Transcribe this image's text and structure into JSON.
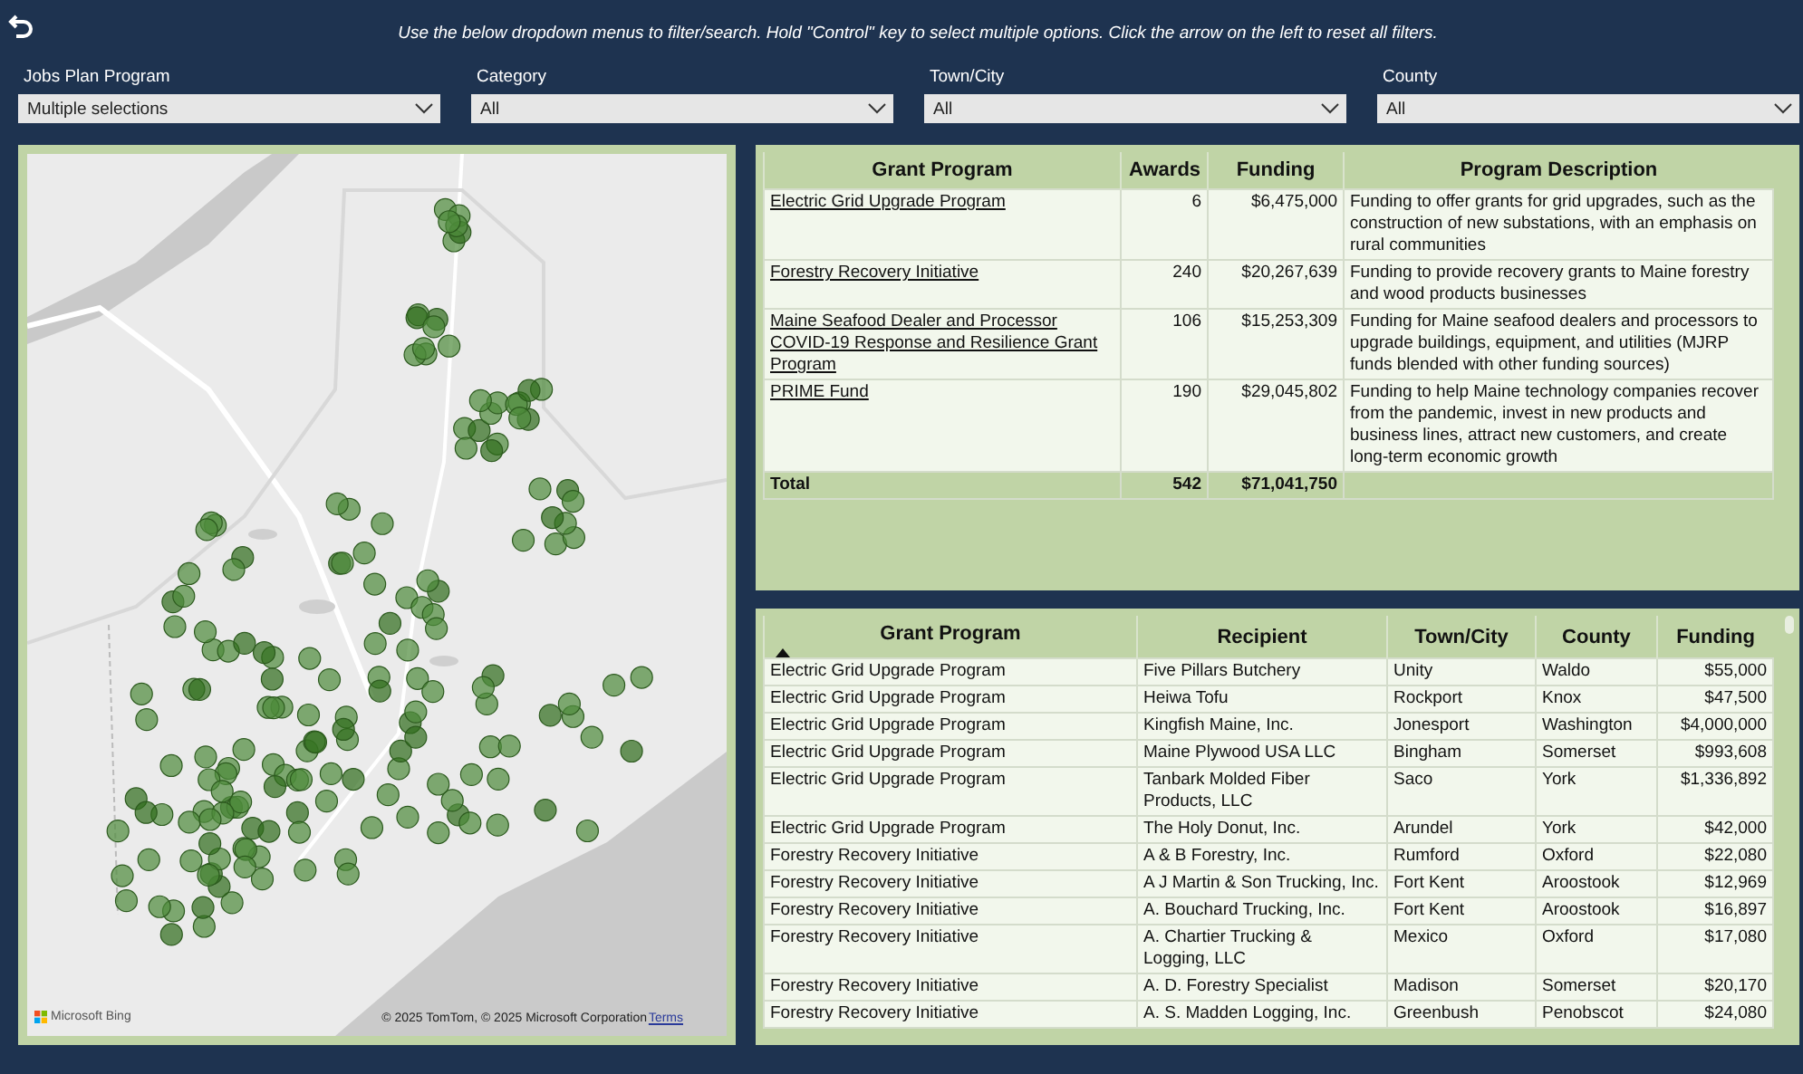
{
  "instructions": "Use the below dropdown menus to filter/search. Hold \"Control\" key to select multiple options. Click the arrow on the left to reset all filters.",
  "filters": [
    {
      "label": "Jobs Plan Program",
      "value": "Multiple selections"
    },
    {
      "label": "Category",
      "value": "All"
    },
    {
      "label": "Town/City",
      "value": "All"
    },
    {
      "label": "County",
      "value": "All"
    }
  ],
  "map": {
    "kind": "picture",
    "logo_text": "Microsoft Bing",
    "attribution": "© 2025 TomTom, © 2025 Microsoft Corporation",
    "terms_link": "Terms"
  },
  "summary_table": {
    "columns": [
      "Grant Program",
      "Awards",
      "Funding",
      "Program Description"
    ],
    "rows": [
      {
        "program": "Electric Grid Upgrade Program",
        "awards": "6",
        "funding": "$6,475,000",
        "description": "Funding to offer grants for grid upgrades, such as the construction of new substations, with an emphasis on rural communities"
      },
      {
        "program": "Forestry Recovery Initiative",
        "awards": "240",
        "funding": "$20,267,639",
        "description": "Funding to provide recovery grants to Maine forestry and wood products businesses"
      },
      {
        "program": "Maine Seafood Dealer and Processor COVID-19 Response and Resilience Grant Program",
        "awards": "106",
        "funding": "$15,253,309",
        "description": "Funding for Maine seafood dealers and processors to upgrade buildings, equipment, and utilities (MJRP funds blended with other funding sources)"
      },
      {
        "program": "PRIME Fund",
        "awards": "190",
        "funding": "$29,045,802",
        "description": "Funding to help Maine technology companies recover from the pandemic, invest in new products and business lines, attract new customers, and create long-term economic growth"
      }
    ],
    "total": {
      "label": "Total",
      "awards": "542",
      "funding": "$71,041,750"
    }
  },
  "detail_table": {
    "columns": [
      {
        "label": "Grant Program",
        "sorted": true
      },
      {
        "label": "Recipient",
        "sorted": false
      },
      {
        "label": "Town/City",
        "sorted": false
      },
      {
        "label": "County",
        "sorted": false
      },
      {
        "label": "Funding",
        "sorted": false
      }
    ],
    "rows": [
      [
        "Electric Grid Upgrade Program",
        "Five Pillars Butchery",
        "Unity",
        "Waldo",
        "$55,000"
      ],
      [
        "Electric Grid Upgrade Program",
        "Heiwa Tofu",
        "Rockport",
        "Knox",
        "$47,500"
      ],
      [
        "Electric Grid Upgrade Program",
        "Kingfish Maine, Inc.",
        "Jonesport",
        "Washington",
        "$4,000,000"
      ],
      [
        "Electric Grid Upgrade Program",
        "Maine Plywood USA LLC",
        "Bingham",
        "Somerset",
        "$993,608"
      ],
      [
        "Electric Grid Upgrade Program",
        "Tanbark Molded Fiber Products, LLC",
        "Saco",
        "York",
        "$1,336,892"
      ],
      [
        "Electric Grid Upgrade Program",
        "The Holy Donut, Inc.",
        "Arundel",
        "York",
        "$42,000"
      ],
      [
        "Forestry Recovery Initiative",
        "A & B Forestry, Inc.",
        "Rumford",
        "Oxford",
        "$22,080"
      ],
      [
        "Forestry Recovery Initiative",
        "A J Martin & Son Trucking, Inc.",
        "Fort Kent",
        "Aroostook",
        "$12,969"
      ],
      [
        "Forestry Recovery Initiative",
        "A. Bouchard Trucking, Inc.",
        "Fort Kent",
        "Aroostook",
        "$16,897"
      ],
      [
        "Forestry Recovery Initiative",
        "A. Chartier Trucking & Logging, LLC",
        "Mexico",
        "Oxford",
        "$17,080"
      ],
      [
        "Forestry Recovery Initiative",
        "A. D. Forestry Specialist",
        "Madison",
        "Somerset",
        "$20,170"
      ],
      [
        "Forestry Recovery Initiative",
        "A. S. Madden Logging, Inc.",
        "Greenbush",
        "Penobscot",
        "$24,080"
      ]
    ]
  }
}
